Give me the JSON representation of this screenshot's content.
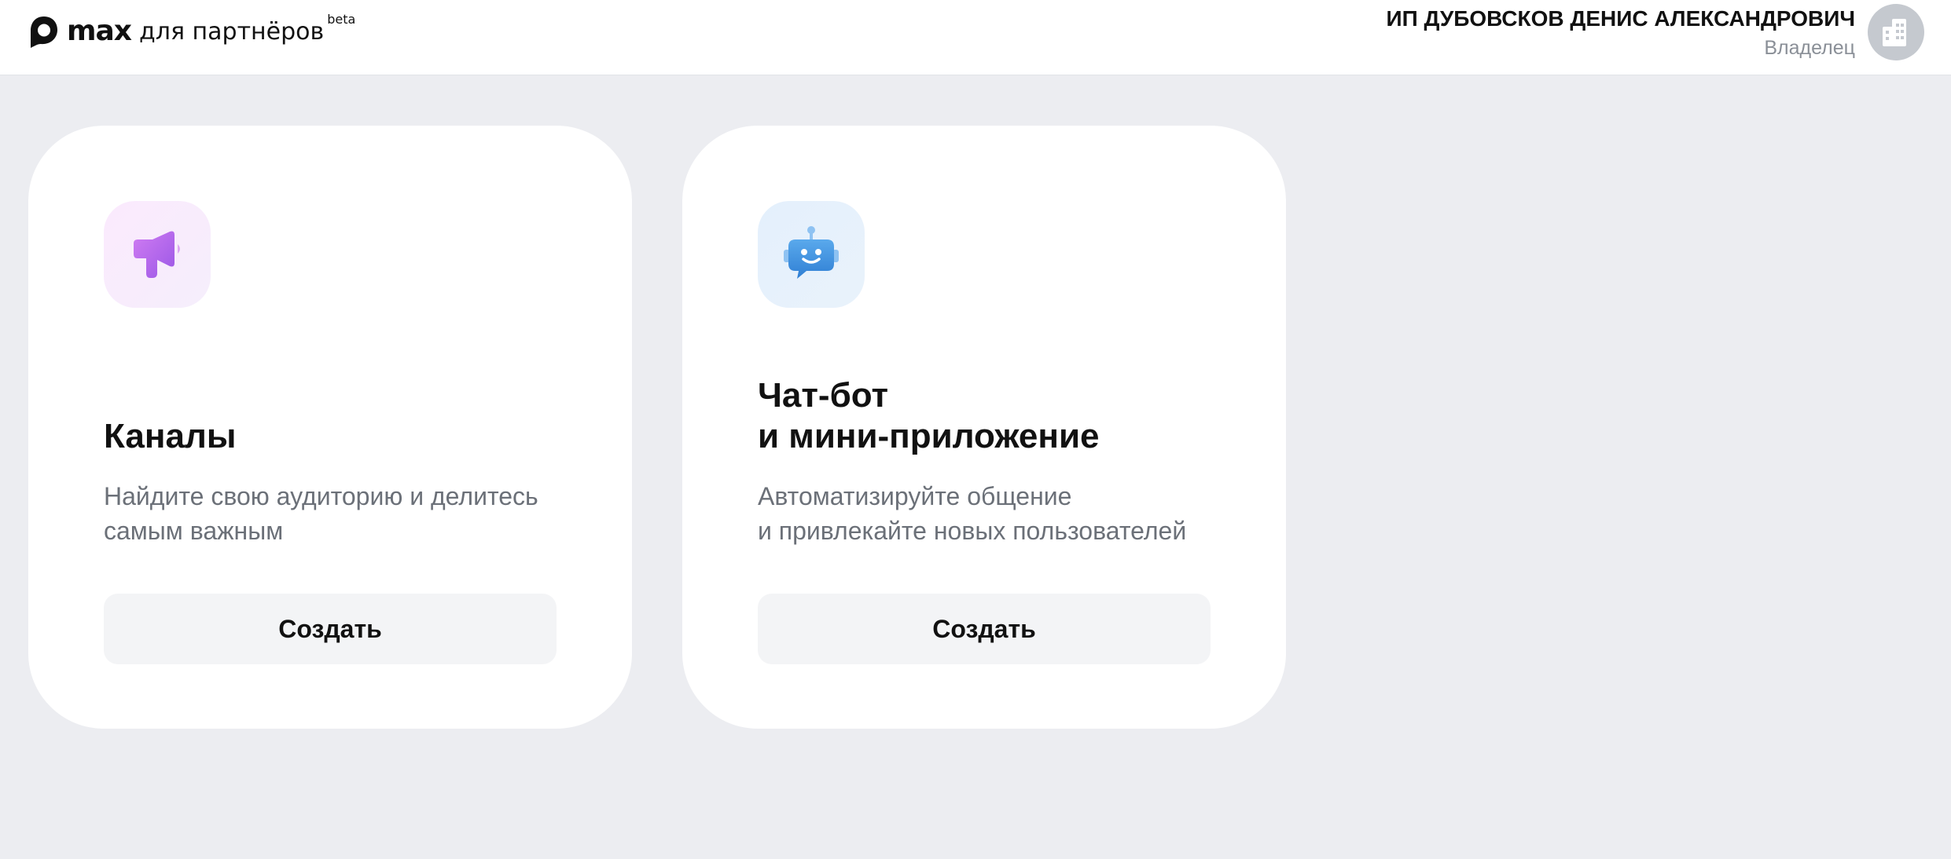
{
  "header": {
    "logo": {
      "brand": "max",
      "tagline": "для партнёров",
      "badge": "beta"
    },
    "user": {
      "name": "ИП ДУБОВСКОВ ДЕНИС АЛЕКСАНДРОВИЧ",
      "role": "Владелец",
      "avatar_icon": "building-icon"
    }
  },
  "cards": [
    {
      "icon": "megaphone-icon",
      "title": "Каналы",
      "description": "Найдите свою аудиторию и делитесь\nсамым важным",
      "button_label": "Создать"
    },
    {
      "icon": "chatbot-icon",
      "title": "Чат-бот\nи мини-приложение",
      "description": "Автоматизируйте общение\nи привлекайте новых пользователей",
      "button_label": "Создать"
    }
  ],
  "colors": {
    "background": "#ecedf1",
    "card": "#ffffff",
    "button": "#f3f4f6",
    "channels_accent": "#b85ee8",
    "chatbot_accent": "#3d8fde",
    "secondary_text": "#6b7078"
  }
}
